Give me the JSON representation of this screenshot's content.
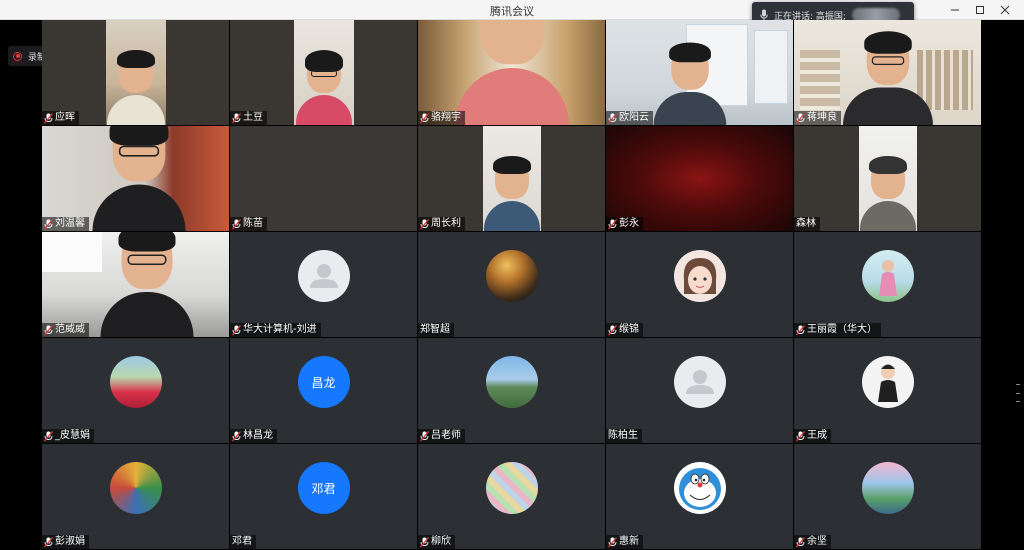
{
  "window": {
    "title": "腾讯会议",
    "controls": [
      "minimize-icon",
      "maximize-icon",
      "close-icon"
    ]
  },
  "speaking": {
    "label": "正在讲话: 高振国;",
    "icon": "microphone-icon"
  },
  "recording": {
    "label": "录制中",
    "icon": "record-icon",
    "color": "#e0383e"
  },
  "participants": [
    {
      "name": "应晖",
      "muted": true,
      "kind": "video"
    },
    {
      "name": "土豆",
      "muted": true,
      "kind": "video"
    },
    {
      "name": "骆翔宇",
      "muted": true,
      "kind": "video"
    },
    {
      "name": "欧阳云",
      "muted": true,
      "kind": "video"
    },
    {
      "name": "蒋坤良",
      "muted": true,
      "kind": "video"
    },
    {
      "name": "刘温馨",
      "muted": true,
      "kind": "video"
    },
    {
      "name": "陈苗",
      "muted": true,
      "kind": "video"
    },
    {
      "name": "周长利",
      "muted": true,
      "kind": "video"
    },
    {
      "name": "彭永",
      "muted": true,
      "kind": "video"
    },
    {
      "name": "森林",
      "muted": false,
      "kind": "video"
    },
    {
      "name": "范威威",
      "muted": true,
      "kind": "video"
    },
    {
      "name": "华大计算机-刘进",
      "muted": true,
      "kind": "avatar"
    },
    {
      "name": "郑智超",
      "muted": false,
      "kind": "avatar"
    },
    {
      "name": "缑锦",
      "muted": true,
      "kind": "avatar"
    },
    {
      "name": "王丽霞（华大）",
      "muted": true,
      "kind": "avatar"
    },
    {
      "name": "_皮慧娟",
      "muted": true,
      "kind": "avatar"
    },
    {
      "name": "林昌龙",
      "muted": true,
      "kind": "avatar",
      "initials": "昌龙"
    },
    {
      "name": "吕老师",
      "muted": true,
      "kind": "avatar"
    },
    {
      "name": "陈柏生",
      "muted": false,
      "kind": "avatar"
    },
    {
      "name": "王成",
      "muted": true,
      "kind": "avatar"
    },
    {
      "name": "彭淑娟",
      "muted": true,
      "kind": "avatar"
    },
    {
      "name": "邓君",
      "muted": false,
      "kind": "avatar",
      "initials": "邓君"
    },
    {
      "name": "柳欣",
      "muted": true,
      "kind": "avatar"
    },
    {
      "name": "惠新",
      "muted": true,
      "kind": "avatar"
    },
    {
      "name": "余坚",
      "muted": true,
      "kind": "avatar"
    }
  ],
  "colors": {
    "tile_bg": "#2c2f33",
    "avatar_blue": "#1677ff",
    "titlebar_bg": "#f5f5f5"
  }
}
